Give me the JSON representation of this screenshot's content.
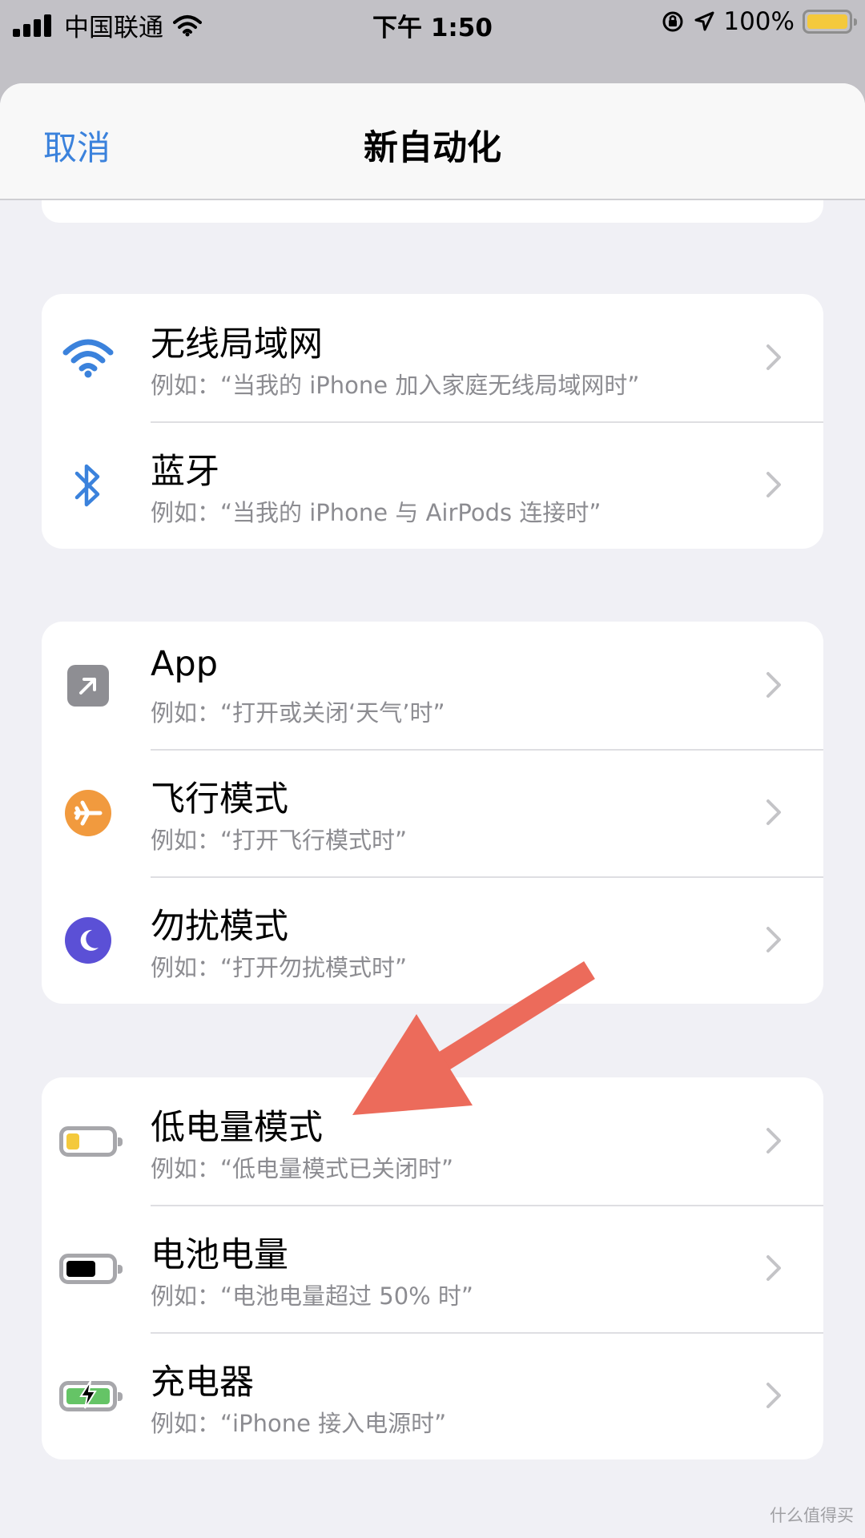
{
  "status_bar": {
    "carrier": "中国联通",
    "time": "下午 1:50",
    "battery_percent": "100%",
    "battery_level": 1.0,
    "icons": [
      "signal-icon",
      "wifi-icon",
      "rotation-lock-icon",
      "location-icon",
      "battery-icon"
    ]
  },
  "nav": {
    "cancel_label": "取消",
    "title": "新自动化"
  },
  "groups": [
    {
      "items": [
        {
          "title": "无线局域网",
          "subtitle": "例如：“当我的 iPhone 加入家庭无线局域网时”",
          "icon": "wifi-icon"
        },
        {
          "title": "蓝牙",
          "subtitle": "例如：“当我的 iPhone 与 AirPods 连接时”",
          "icon": "bluetooth-icon"
        }
      ]
    },
    {
      "items": [
        {
          "title": "App",
          "subtitle": "例如：“打开或关闭‘天气’时”",
          "icon": "app-arrow-icon"
        },
        {
          "title": "飞行模式",
          "subtitle": "例如：“打开飞行模式时”",
          "icon": "airplane-icon"
        },
        {
          "title": "勿扰模式",
          "subtitle": "例如：“打开勿扰模式时”",
          "icon": "moon-icon"
        }
      ]
    },
    {
      "items": [
        {
          "title": "低电量模式",
          "subtitle": "例如：“低电量模式已关闭时”",
          "icon": "low-battery-icon"
        },
        {
          "title": "电池电量",
          "subtitle": "例如：“电池电量超过 50% 时”",
          "icon": "battery-level-icon"
        },
        {
          "title": "充电器",
          "subtitle": "例如：“iPhone 接入电源时”",
          "icon": "charging-battery-icon"
        }
      ]
    }
  ],
  "colors": {
    "accent": "#3b82dc",
    "airplane": "#f19a3e",
    "moon": "#5b50d6",
    "low_battery": "#f4c93c",
    "charging": "#65c466",
    "annotation_arrow": "#ec6b5b"
  },
  "watermark": "什么值得买"
}
